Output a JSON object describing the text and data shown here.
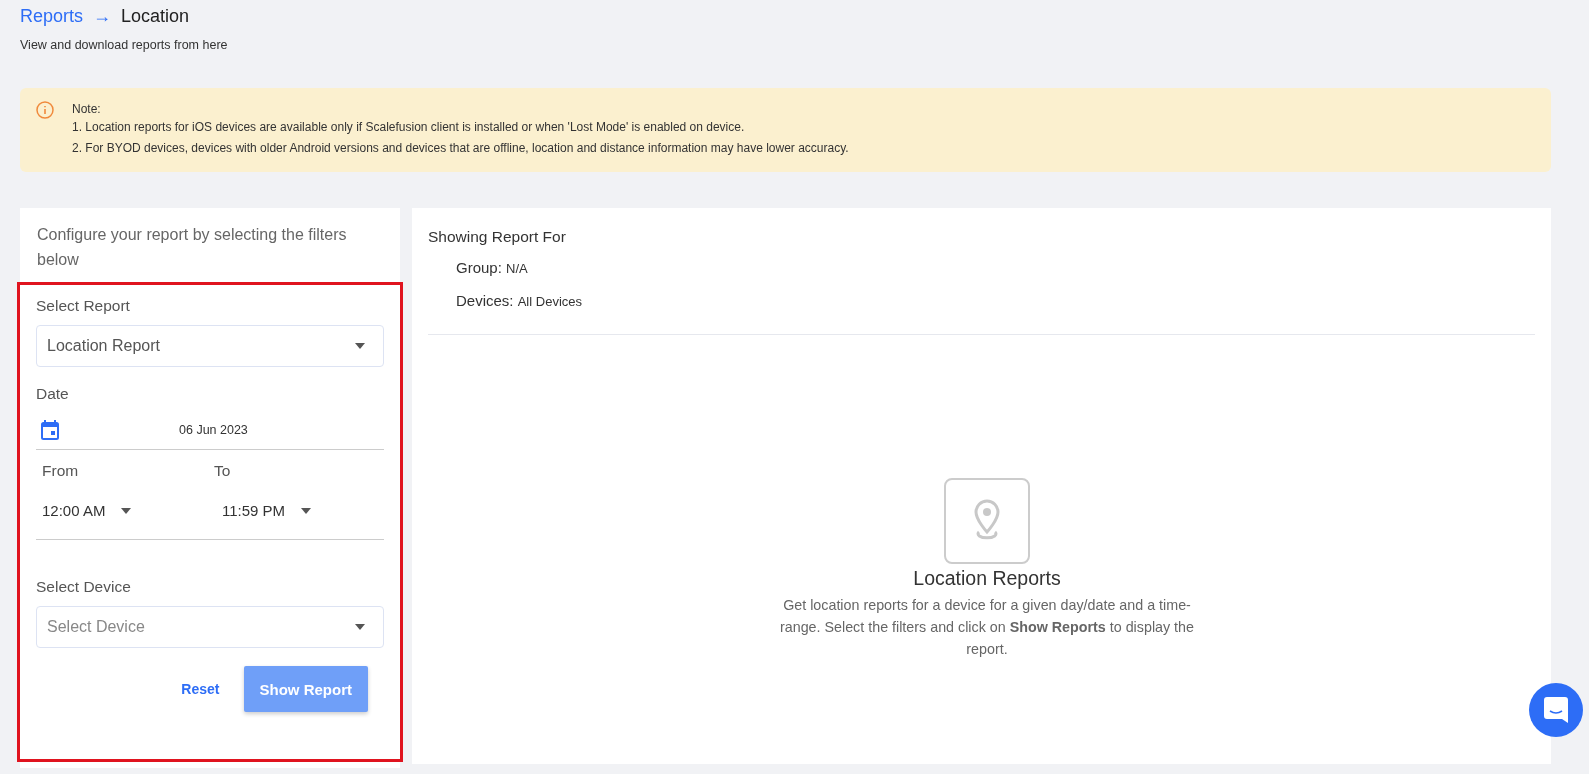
{
  "breadcrumb": {
    "parent": "Reports",
    "separator": "→",
    "current": "Location"
  },
  "subtitle": "View and download reports from here",
  "note": {
    "title": "Note:",
    "lines": [
      "1. Location reports for iOS devices are available only if Scalefusion client is installed or when 'Lost Mode' is enabled on device.",
      "2. For BYOD devices, devices with older Android versions and devices that are offline, location and distance information may have lower accuracy."
    ]
  },
  "filters": {
    "intro": "Configure your report by selecting the filters below",
    "highlighted": true,
    "report_label": "Select Report",
    "report_value": "Location Report",
    "date_label": "Date",
    "date_value": "06 Jun 2023",
    "from_label": "From",
    "from_value": "12:00 AM",
    "to_label": "To",
    "to_value": "11:59 PM",
    "device_label": "Select Device",
    "device_placeholder": "Select Device",
    "reset": "Reset",
    "show": "Show Report"
  },
  "report": {
    "heading": "Showing Report For",
    "fields": [
      {
        "label": "Group:",
        "value": "N/A"
      },
      {
        "label": "Devices:",
        "value": "All Devices"
      }
    ],
    "empty_title": "Location Reports",
    "empty_text": "Get location reports for a device for a given day/date and a time-range. Select the filters and click on **Show Reports** to display the report."
  }
}
